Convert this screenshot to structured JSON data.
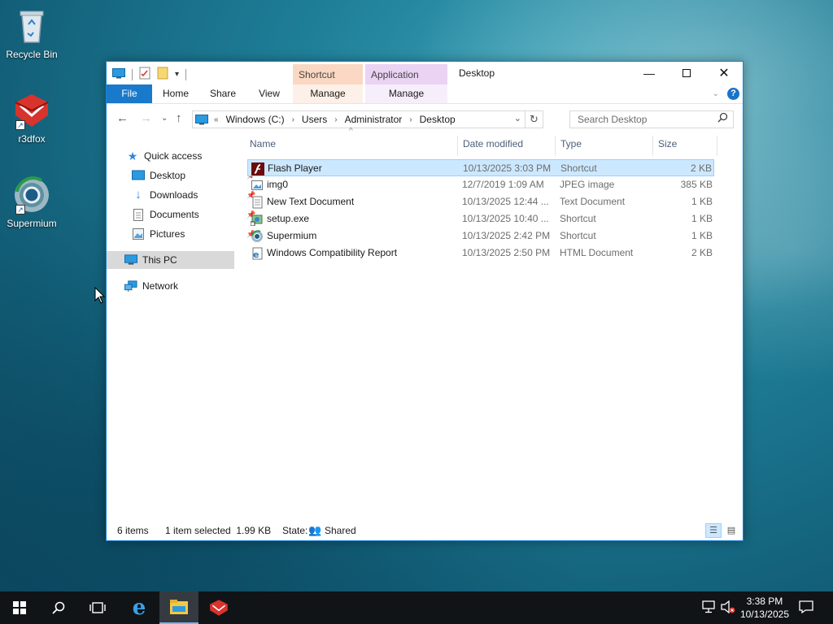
{
  "desktop": {
    "icons": [
      {
        "label": "Recycle Bin",
        "icon": "recycle-bin-icon"
      },
      {
        "label": "r3dfox",
        "icon": "r3dfox-icon"
      },
      {
        "label": "Supermium",
        "icon": "supermium-icon"
      }
    ]
  },
  "window": {
    "title": "Desktop",
    "context_tabs": {
      "shortcut_tools": "Shortcut Tools",
      "application_tools": "Application Tools"
    },
    "ribbon_tabs": [
      "File",
      "Home",
      "Share",
      "View",
      "Manage",
      "Manage"
    ],
    "breadcrumb": [
      "Windows (C:)",
      "Users",
      "Administrator",
      "Desktop"
    ],
    "breadcrumb_prefix": "«",
    "search_placeholder": "Search Desktop",
    "nav": {
      "quick_access": "Quick access",
      "items": [
        {
          "label": "Desktop",
          "icon": "desktop-folder-icon",
          "pinned": true
        },
        {
          "label": "Downloads",
          "icon": "downloads-icon",
          "pinned": true
        },
        {
          "label": "Documents",
          "icon": "documents-icon",
          "pinned": true
        },
        {
          "label": "Pictures",
          "icon": "pictures-icon",
          "pinned": true
        }
      ],
      "this_pc": "This PC",
      "network": "Network"
    },
    "columns": {
      "name": "Name",
      "date": "Date modified",
      "type": "Type",
      "size": "Size"
    },
    "files": [
      {
        "name": "Flash Player",
        "date": "10/13/2025 3:03 PM",
        "type": "Shortcut",
        "size": "2 KB",
        "selected": true,
        "icon": "flash-player-icon"
      },
      {
        "name": "img0",
        "date": "12/7/2019 1:09 AM",
        "type": "JPEG image",
        "size": "385 KB",
        "selected": false,
        "icon": "image-file-icon"
      },
      {
        "name": "New Text Document",
        "date": "10/13/2025 12:44 ...",
        "type": "Text Document",
        "size": "1 KB",
        "selected": false,
        "icon": "text-file-icon"
      },
      {
        "name": "setup.exe",
        "date": "10/13/2025 10:40 ...",
        "type": "Shortcut",
        "size": "1 KB",
        "selected": false,
        "icon": "setup-icon"
      },
      {
        "name": "Supermium",
        "date": "10/13/2025 2:42 PM",
        "type": "Shortcut",
        "size": "1 KB",
        "selected": false,
        "icon": "supermium-icon"
      },
      {
        "name": "Windows Compatibility Report",
        "date": "10/13/2025 2:50 PM",
        "type": "HTML Document",
        "size": "2 KB",
        "selected": false,
        "icon": "html-file-icon"
      }
    ],
    "status": {
      "item_count": "6 items",
      "selection": "1 item selected  1.99 KB",
      "state_label": "State:",
      "state_value": "Shared"
    }
  },
  "taskbar": {
    "time": "3:38 PM",
    "date": "10/13/2025"
  }
}
